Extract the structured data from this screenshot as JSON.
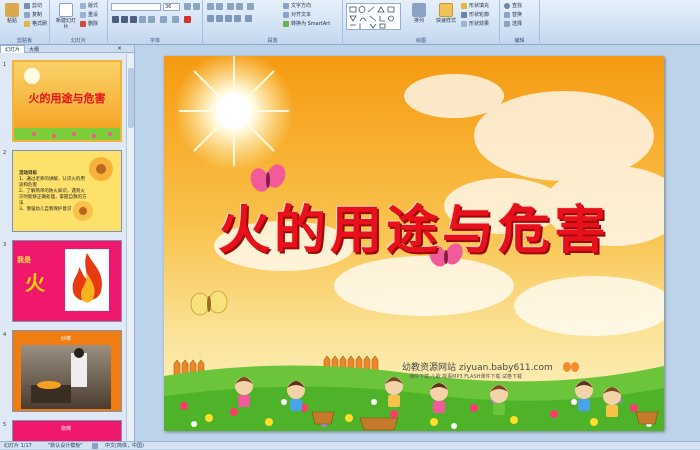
{
  "ribbon": {
    "groups": {
      "clipboard": "剪贴板",
      "slides": "幻灯片",
      "font": "字体",
      "paragraph": "段落",
      "drawing": "绘图",
      "editing": "编辑"
    },
    "paste": "粘贴",
    "cut": "剪切",
    "copy": "复制",
    "format_painter": "格式刷",
    "new_slide": "新建幻灯片",
    "layout": "版式",
    "reset": "重设",
    "delete": "删除",
    "font_size": "36",
    "text_direction": "文字方向",
    "align_text": "对齐文本",
    "convert_smartart": "转换为 SmartArt",
    "arrange": "排列",
    "quick_styles": "快速样式",
    "shape_fill": "形状填充",
    "shape_outline": "形状轮廓",
    "shape_effects": "形状效果",
    "find": "查找",
    "replace": "替换",
    "select": "选择"
  },
  "panel": {
    "tab_slides": "幻灯片",
    "tab_outline": "大纲",
    "close": "×",
    "thumbnails": [
      {
        "num": "1",
        "title": "火的用途与危害"
      },
      {
        "num": "2",
        "title": "活动目标",
        "lines": [
          "1、通过老师的讲解，认识火的用途和危害",
          "2、了解简单的防火知识，遇到火灾时能够正确处理，掌握自救的方法",
          "3、增强幼儿自我保护意识"
        ]
      },
      {
        "num": "3",
        "title": "我是",
        "big": "火"
      },
      {
        "num": "4",
        "title": "炒菜"
      },
      {
        "num": "5",
        "title": "烧烤"
      }
    ]
  },
  "slide": {
    "title": "火的用途与危害",
    "watermark": "幼教资源网站  ziyuan.baby611.com",
    "watermark_sub": "课件下载  儿歌  故事MP3  FLASH课件下载  试卷下载"
  },
  "status": {
    "slide_info": "幻灯片 1/17",
    "theme": "\"默认设计模板\"",
    "language": "中文(简体，中国)"
  },
  "colors": {
    "title_red": "#e8101a",
    "ribbon_bg": "#cfe0f3",
    "slide_sky": "#f7a21a"
  }
}
